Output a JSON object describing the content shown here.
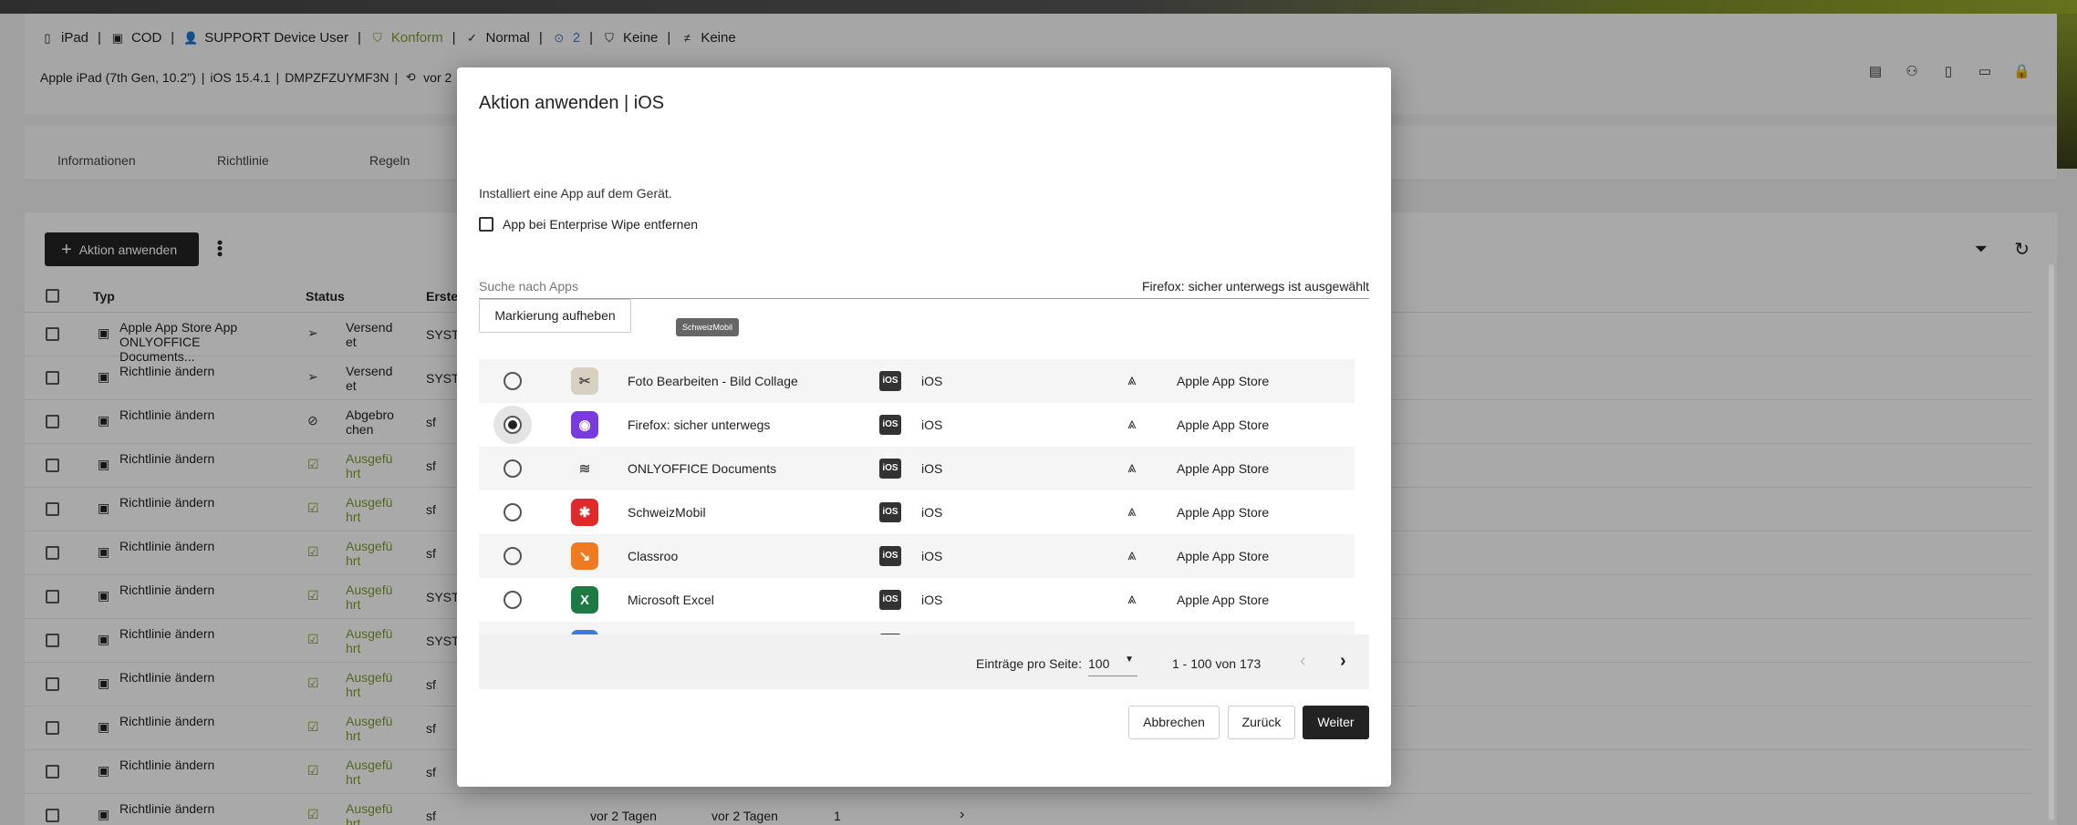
{
  "header": {
    "device_label": "iPad",
    "ownership": "COD",
    "user": "SUPPORT Device User",
    "compliance": "Konform",
    "mode": "Normal",
    "count": "2",
    "security": "Keine",
    "restriction": "Keine",
    "model": "Apple iPad (7th Gen, 10.2\")",
    "os_version": "iOS 15.4.1",
    "serial": "DMPZFZUYMF3N",
    "last_seen": "vor 2"
  },
  "tabs": [
    "Informationen",
    "Richtlinie",
    "Regeln"
  ],
  "toolbar": {
    "action_label": "Aktion anwenden"
  },
  "table": {
    "columns": {
      "typ": "Typ",
      "status": "Status",
      "ersteller": "Erstel"
    },
    "rows": [
      {
        "type": "Apple App Store App ONLYOFFICE Documents...",
        "status": "Versend et",
        "status_kind": "sent",
        "by": "SYSTE",
        "d1": "",
        "d2": "",
        "n": ""
      },
      {
        "type": "Richtlinie ändern",
        "status": "Versend et",
        "status_kind": "sent",
        "by": "SYSTE",
        "d1": "",
        "d2": "",
        "n": ""
      },
      {
        "type": "Richtlinie ändern",
        "status": "Abgebro chen",
        "status_kind": "cancel",
        "by": "sf",
        "d1": "",
        "d2": "",
        "n": ""
      },
      {
        "type": "Richtlinie ändern",
        "status": "Ausgefü hrt",
        "status_kind": "done",
        "by": "sf",
        "d1": "",
        "d2": "",
        "n": ""
      },
      {
        "type": "Richtlinie ändern",
        "status": "Ausgefü hrt",
        "status_kind": "done",
        "by": "sf",
        "d1": "",
        "d2": "",
        "n": ""
      },
      {
        "type": "Richtlinie ändern",
        "status": "Ausgefü hrt",
        "status_kind": "done",
        "by": "sf",
        "d1": "",
        "d2": "",
        "n": ""
      },
      {
        "type": "Richtlinie ändern",
        "status": "Ausgefü hrt",
        "status_kind": "done",
        "by": "SYSTE",
        "d1": "",
        "d2": "",
        "n": ""
      },
      {
        "type": "Richtlinie ändern",
        "status": "Ausgefü hrt",
        "status_kind": "done",
        "by": "SYSTE",
        "d1": "",
        "d2": "",
        "n": ""
      },
      {
        "type": "Richtlinie ändern",
        "status": "Ausgefü hrt",
        "status_kind": "done",
        "by": "sf",
        "d1": "",
        "d2": "",
        "n": ""
      },
      {
        "type": "Richtlinie ändern",
        "status": "Ausgefü hrt",
        "status_kind": "done",
        "by": "sf",
        "d1": "",
        "d2": "",
        "n": ""
      },
      {
        "type": "Richtlinie ändern",
        "status": "Ausgefü hrt",
        "status_kind": "done",
        "by": "sf",
        "d1": "",
        "d2": "",
        "n": ""
      },
      {
        "type": "Richtlinie ändern",
        "status": "Ausgefü hrt",
        "status_kind": "done",
        "by": "sf",
        "d1": "vor 2 Tagen",
        "d2": "vor 2 Tagen",
        "n": "1"
      }
    ]
  },
  "modal": {
    "title": "Aktion anwenden | iOS",
    "description": "Installiert eine App auf dem Gerät.",
    "wipe_label": "App bei Enterprise Wipe entfernen",
    "search_placeholder": "Suche nach Apps",
    "selected_text": "Firefox: sicher unterwegs ist ausgewählt",
    "clear_label": "Markierung aufheben",
    "apps": [
      {
        "name": "Foto Bearbeiten - Bild Collage",
        "os": "iOS",
        "store": "Apple App Store",
        "selected": false,
        "icon": "photo-collage-icon",
        "color": "#d8d0c0",
        "glyph": "✂"
      },
      {
        "name": "Firefox: sicher unterwegs",
        "os": "iOS",
        "store": "Apple App Store",
        "selected": true,
        "icon": "firefox-icon",
        "color": "#7a3ae0",
        "glyph": "◉"
      },
      {
        "name": "ONLYOFFICE Documents",
        "os": "iOS",
        "store": "Apple App Store",
        "selected": false,
        "icon": "onlyoffice-icon",
        "color": "#f4f4f4",
        "glyph": "≋"
      },
      {
        "name": "SchweizMobil",
        "os": "iOS",
        "store": "Apple App Store",
        "selected": false,
        "icon": "schweizmobil-icon",
        "color": "#e02a2a",
        "glyph": "✱"
      },
      {
        "name": "Classroo",
        "os": "iOS",
        "store": "Apple App Store",
        "selected": false,
        "icon": "classroom-icon",
        "color": "#f07a20",
        "glyph": "↘"
      },
      {
        "name": "Microsoft Excel",
        "os": "iOS",
        "store": "Apple App Store",
        "selected": false,
        "icon": "excel-icon",
        "color": "#1d7a42",
        "glyph": "X"
      }
    ],
    "os_badge": "iOS",
    "tooltip": "SchweizMobil",
    "pager": {
      "per_page_label": "Einträge pro Seite:",
      "per_page": "100",
      "range": "1 - 100 von 173"
    },
    "buttons": {
      "cancel": "Abbrechen",
      "back": "Zurück",
      "next": "Weiter"
    }
  }
}
